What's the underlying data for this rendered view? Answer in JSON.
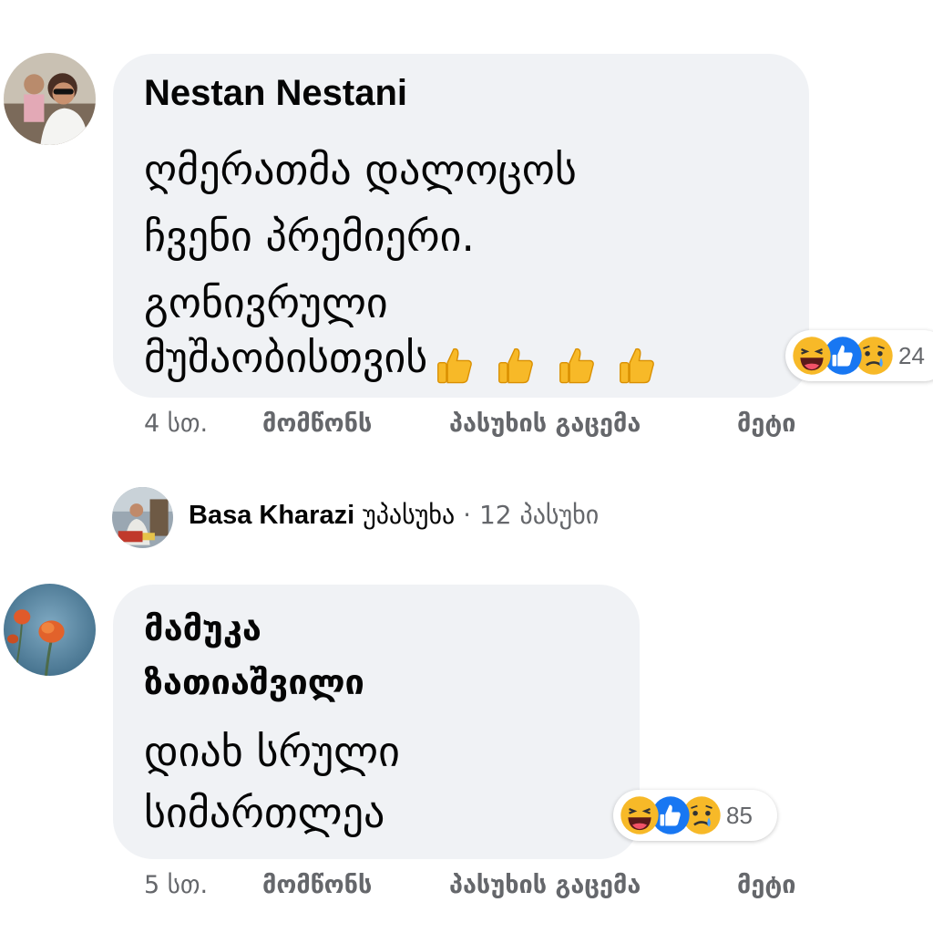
{
  "comments": [
    {
      "author": "Nestan Nestani",
      "text_lines": [
        "ღმერათმა დალოცოს",
        "ჩვენი პრემიერი.",
        "გონივრული",
        "მუშაობისთვის"
      ],
      "trailing_emoji": "thumbs-up-icon x4",
      "reactions": {
        "icons": [
          "haha-icon",
          "like-icon",
          "sad-icon"
        ],
        "count": "24"
      },
      "time": "4 სთ.",
      "like_label": "მომწონს",
      "reply_label": "პასუხის გაცემა",
      "more_label": "მეტი"
    },
    {
      "author_lines": [
        "მამუკა",
        "ზათიაშვილი"
      ],
      "text_lines": [
        "დიახ სრული",
        "სიმართლეა"
      ],
      "reactions": {
        "icons": [
          "haha-icon",
          "like-icon",
          "sad-icon"
        ],
        "count": "85"
      },
      "time": "5 სთ.",
      "like_label": "მომწონს",
      "reply_label": "პასუხის გაცემა",
      "more_label": "მეტი"
    }
  ],
  "reply_summary": {
    "name": "Basa Kharazi",
    "verb": "უპასუხა",
    "separator": "·",
    "count_text": "12 პასუხი"
  },
  "colors": {
    "bubble": "#f0f2f5",
    "secondary_text": "#65676b",
    "like_blue": "#1877f2",
    "emoji_yellow": "#f7b928"
  }
}
